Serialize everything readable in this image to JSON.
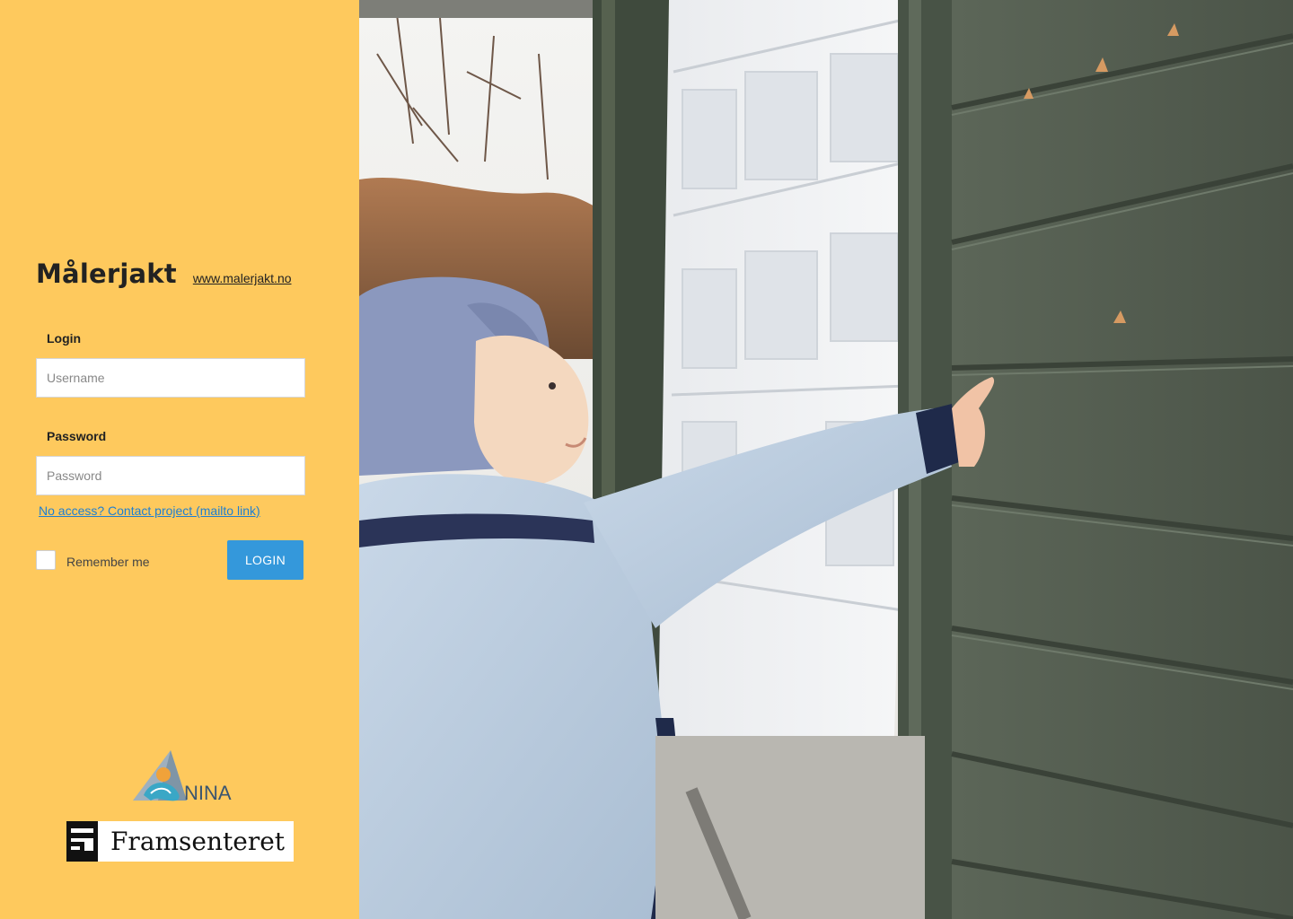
{
  "brand": {
    "title": "Målerjakt",
    "website_link": "www.malerjakt.no"
  },
  "login_form": {
    "login_label": "Login",
    "username_placeholder": "Username",
    "password_label": "Password",
    "password_placeholder": "Password",
    "contact_link": "No access? Contact project (mailto link)",
    "remember_label": "Remember me",
    "remember_checked": false,
    "submit_label": "LOGIN"
  },
  "logos": {
    "nina_text": "NINA",
    "fram_text": "Framsenteret"
  },
  "colors": {
    "sidebar_bg": "#fec95d",
    "button_bg": "#3498db",
    "link": "#1f7fd1"
  }
}
